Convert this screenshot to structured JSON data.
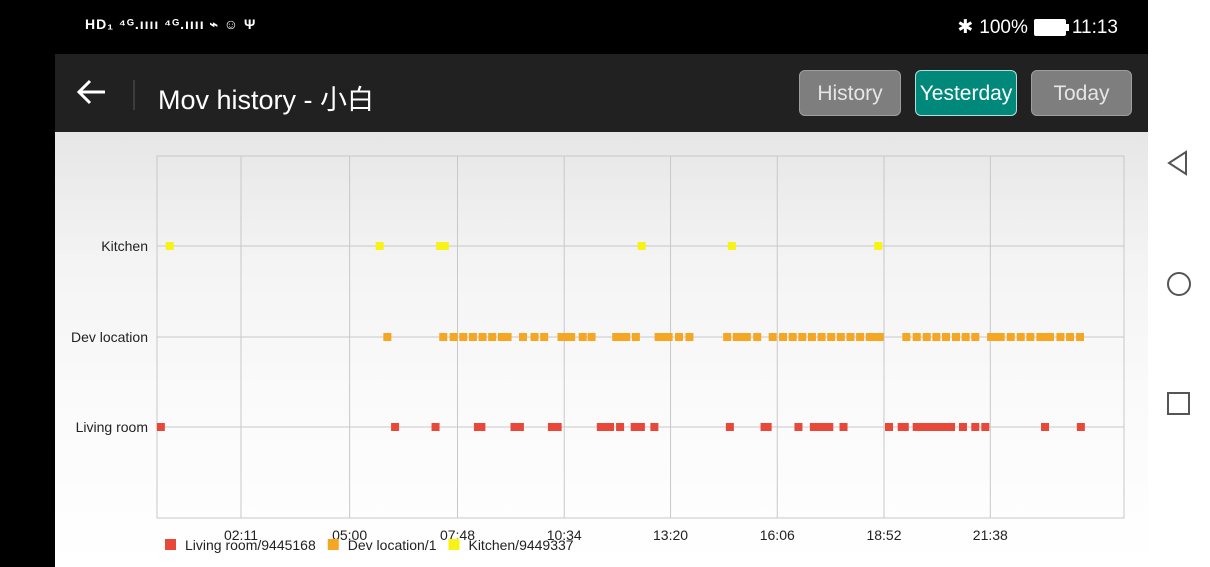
{
  "status_bar": {
    "left_text": "HD₁ ⁴ᴳ.ıııı ⁴ᴳ.ıııı ⌁ ☺ Ψ",
    "bluetooth": "✱",
    "battery": "100%",
    "time": "11:13"
  },
  "app_bar": {
    "title": "Mov history - 小白",
    "buttons": {
      "history": "History",
      "yesterday": "Yesterday",
      "today": "Today"
    }
  },
  "colors": {
    "living_room": "#e8483a",
    "dev_location": "#f5a623",
    "kitchen": "#f7f314",
    "active_button": "#00897b",
    "app_bar": "#212121"
  },
  "chart_data": {
    "type": "scatter",
    "title": "",
    "xlabel": "",
    "ylabel": "",
    "x_unit": "time of day (hours)",
    "xlim": [
      0,
      25.1
    ],
    "x_tick_labels": [
      "02:11",
      "05:00",
      "07:48",
      "10:34",
      "13:20",
      "16:06",
      "18:52",
      "21:38"
    ],
    "x_tick_values": [
      2.18,
      5.0,
      7.8,
      10.57,
      13.33,
      16.1,
      18.87,
      21.63
    ],
    "categories": [
      "Living room",
      "Dev location",
      "Kitchen"
    ],
    "grid": true,
    "legend_position": "bottom-left",
    "series": [
      {
        "name": "Living room/9445168",
        "category": "Living room",
        "color": "#e8483a",
        "x": [
          0.1,
          6.18,
          7.23,
          8.33,
          8.42,
          9.28,
          9.35,
          9.42,
          10.25,
          10.32,
          10.4,
          11.52,
          11.6,
          11.68,
          11.76,
          12.02,
          12.4,
          12.48,
          12.56,
          12.91,
          14.87,
          15.77,
          15.85,
          16.65,
          17.05,
          17.13,
          17.21,
          17.29,
          17.37,
          17.45,
          17.82,
          19.0,
          19.33,
          19.41,
          19.72,
          19.8,
          19.88,
          20.05,
          20.13,
          20.21,
          20.29,
          20.37,
          20.45,
          20.53,
          20.61,
          20.92,
          21.24,
          21.5,
          23.05,
          23.98
        ],
        "y": [
          "Living room",
          "Living room",
          "Living room",
          "Living room",
          "Living room",
          "Living room",
          "Living room",
          "Living room",
          "Living room",
          "Living room",
          "Living room",
          "Living room",
          "Living room",
          "Living room",
          "Living room",
          "Living room",
          "Living room",
          "Living room",
          "Living room",
          "Living room",
          "Living room",
          "Living room",
          "Living room",
          "Living room",
          "Living room",
          "Living room",
          "Living room",
          "Living room",
          "Living room",
          "Living room",
          "Living room",
          "Living room",
          "Living room",
          "Living room",
          "Living room",
          "Living room",
          "Living room",
          "Living room",
          "Living room",
          "Living room",
          "Living room",
          "Living room",
          "Living room",
          "Living room",
          "Living room",
          "Living room",
          "Living room",
          "Living room",
          "Living room",
          "Living room"
        ]
      },
      {
        "name": "Dev location/1",
        "category": "Dev location",
        "color": "#f5a623",
        "x": [
          5.98,
          7.43,
          7.7,
          7.95,
          8.2,
          8.45,
          8.7,
          8.95,
          9.1,
          9.5,
          9.8,
          10.05,
          10.5,
          10.62,
          10.75,
          11.05,
          11.28,
          11.92,
          12.05,
          12.18,
          12.43,
          13.02,
          13.15,
          13.28,
          13.55,
          13.82,
          14.8,
          15.05,
          15.18,
          15.31,
          15.58,
          15.98,
          16.25,
          16.5,
          16.75,
          17.0,
          17.25,
          17.5,
          17.75,
          18.0,
          18.25,
          18.5,
          18.63,
          18.76,
          19.45,
          19.72,
          19.98,
          20.23,
          20.48,
          20.74,
          20.99,
          21.24,
          21.65,
          21.78,
          21.9,
          22.16,
          22.42,
          22.67,
          22.93,
          23.06,
          23.18,
          23.45,
          23.7,
          23.96
        ],
        "y": [
          "Dev location",
          "Dev location",
          "Dev location",
          "Dev location",
          "Dev location",
          "Dev location",
          "Dev location",
          "Dev location",
          "Dev location",
          "Dev location",
          "Dev location",
          "Dev location",
          "Dev location",
          "Dev location",
          "Dev location",
          "Dev location",
          "Dev location",
          "Dev location",
          "Dev location",
          "Dev location",
          "Dev location",
          "Dev location",
          "Dev location",
          "Dev location",
          "Dev location",
          "Dev location",
          "Dev location",
          "Dev location",
          "Dev location",
          "Dev location",
          "Dev location",
          "Dev location",
          "Dev location",
          "Dev location",
          "Dev location",
          "Dev location",
          "Dev location",
          "Dev location",
          "Dev location",
          "Dev location",
          "Dev location",
          "Dev location",
          "Dev location",
          "Dev location",
          "Dev location",
          "Dev location",
          "Dev location",
          "Dev location",
          "Dev location",
          "Dev location",
          "Dev location",
          "Dev location",
          "Dev location",
          "Dev location",
          "Dev location",
          "Dev location",
          "Dev location",
          "Dev location",
          "Dev location",
          "Dev location",
          "Dev location",
          "Dev location",
          "Dev location",
          "Dev location"
        ]
      },
      {
        "name": "Kitchen/9449337",
        "category": "Kitchen",
        "color": "#f7f314",
        "x": [
          0.33,
          5.78,
          7.35,
          7.47,
          12.58,
          14.92,
          18.72
        ],
        "y": [
          "Kitchen",
          "Kitchen",
          "Kitchen",
          "Kitchen",
          "Kitchen",
          "Kitchen",
          "Kitchen"
        ]
      }
    ]
  }
}
